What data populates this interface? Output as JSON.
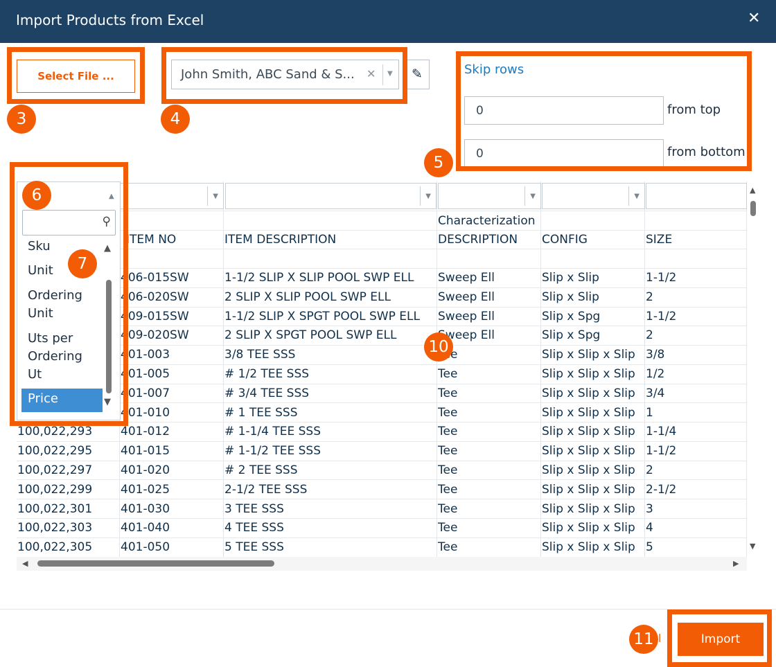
{
  "dialog": {
    "title": "Import Products from Excel"
  },
  "select_file": {
    "label": "Select File ..."
  },
  "supplier": {
    "value": "John Smith, ABC Sand & S..."
  },
  "skip_rows": {
    "label": "Skip rows",
    "top_value": "0",
    "top_label": "from top",
    "bottom_value": "0",
    "bottom_label": "from bottom"
  },
  "badges": [
    "3",
    "4",
    "5",
    "6",
    "7",
    "10",
    "11"
  ],
  "grid": {
    "header_row1": [
      "",
      "",
      "",
      "Characterization",
      "",
      ""
    ],
    "header_row2": [
      "",
      "ITEM NO",
      "ITEM DESCRIPTION",
      "DESCRIPTION",
      "CONFIG",
      "SIZE"
    ],
    "rows": [
      [
        "",
        "406-015SW",
        "1-1/2 SLIP X SLIP POOL SWP ELL",
        "Sweep Ell",
        "Slip x Slip",
        "1-1/2"
      ],
      [
        "",
        "406-020SW",
        "2 SLIP X SLIP POOL SWP ELL",
        "Sweep Ell",
        "Slip x Slip",
        "2"
      ],
      [
        "",
        "409-015SW",
        "1-1/2 SLIP X SPGT POOL SWP ELL",
        "Sweep Ell",
        "Slip x Spg",
        "1-1/2"
      ],
      [
        "",
        "409-020SW",
        "2 SLIP X SPGT POOL SWP ELL",
        "Sweep Ell",
        "Slip x Spg",
        "2"
      ],
      [
        "",
        "401-003",
        "3/8 TEE SSS",
        "Tee",
        "Slip x Slip x Slip",
        "3/8"
      ],
      [
        "",
        "401-005",
        "# 1/2 TEE SSS",
        "Tee",
        "Slip x Slip x Slip",
        "1/2"
      ],
      [
        "",
        "401-007",
        "# 3/4 TEE SSS",
        "Tee",
        "Slip x Slip x Slip",
        "3/4"
      ],
      [
        "",
        "401-010",
        "# 1 TEE SSS",
        "Tee",
        "Slip x Slip x Slip",
        "1"
      ],
      [
        "100,022,293",
        "401-012",
        "# 1-1/4 TEE SSS",
        "Tee",
        "Slip x Slip x Slip",
        "1-1/4"
      ],
      [
        "100,022,295",
        "401-015",
        "# 1-1/2 TEE SSS",
        "Tee",
        "Slip x Slip x Slip",
        "1-1/2"
      ],
      [
        "100,022,297",
        "401-020",
        "# 2 TEE SSS",
        "Tee",
        "Slip x Slip x Slip",
        "2"
      ],
      [
        "100,022,299",
        "401-025",
        "2-1/2 TEE SSS",
        "Tee",
        "Slip x Slip x Slip",
        "2-1/2"
      ],
      [
        "100,022,301",
        "401-030",
        "3 TEE SSS",
        "Tee",
        "Slip x Slip x Slip",
        "3"
      ],
      [
        "100,022,303",
        "401-040",
        "4 TEE SSS",
        "Tee",
        "Slip x Slip x Slip",
        "4"
      ],
      [
        "100,022,305",
        "401-050",
        "5 TEE SSS",
        "Tee",
        "Slip x Slip x Slip",
        "5"
      ]
    ]
  },
  "column_dropdown": {
    "items": [
      "Sku",
      "Unit",
      "Ordering Unit",
      "Uts per Ordering Ut"
    ],
    "selected": "Price"
  },
  "footer": {
    "cancel_label": "el",
    "import_label": "Import"
  },
  "colors": {
    "header_bg": "#1d4264",
    "accent": "#f25c05",
    "link": "#1b7bc1",
    "selected_bg": "#3d8ed3"
  }
}
